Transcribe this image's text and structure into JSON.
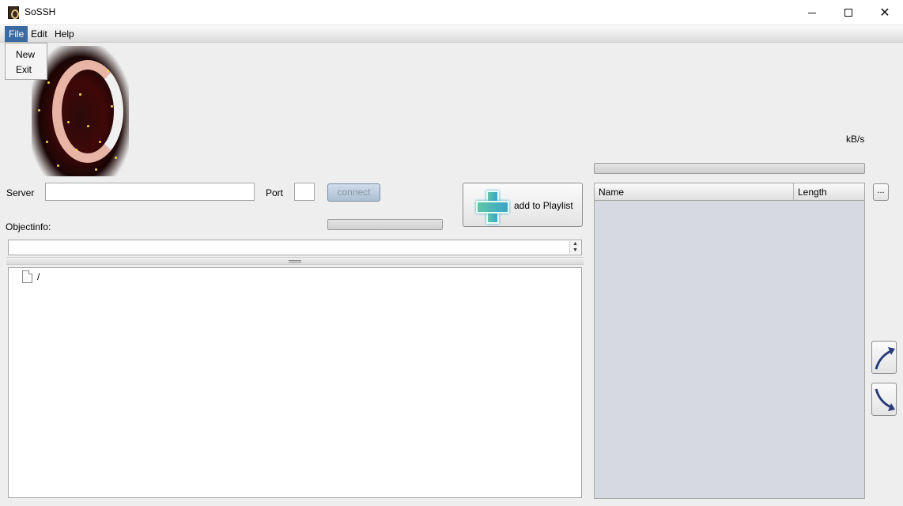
{
  "window": {
    "title": "SoSSH",
    "minimize_glyph": "",
    "close_glyph": "✕"
  },
  "menubar": {
    "items": [
      "File",
      "Edit",
      "Help"
    ]
  },
  "file_menu": {
    "items": [
      "New",
      "Exit"
    ]
  },
  "connection": {
    "server_label": "Server",
    "server_value": "",
    "port_label": "Port",
    "port_value": "",
    "connect_label": "connect",
    "objectinfo_label": "Objectinfo:"
  },
  "playlist": {
    "add_label": "add to Playlist",
    "speed_unit": "kB/s",
    "columns": [
      "Name",
      "Length"
    ],
    "browse_label": "..."
  },
  "tree": {
    "root": "/"
  },
  "colors": {
    "menu_highlight": "#3b6aa0",
    "table_background": "#d6d9df",
    "connect_button": "#aebfd3"
  },
  "icons": [
    "app-icon",
    "plus-icon",
    "file-icon",
    "move-up-icon",
    "move-down-icon"
  ]
}
